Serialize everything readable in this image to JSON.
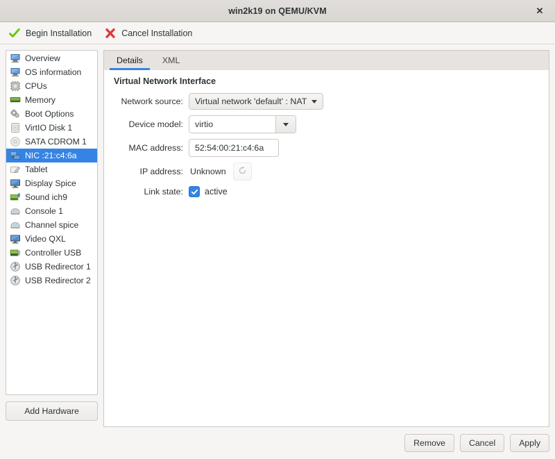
{
  "window": {
    "title": "win2k19 on QEMU/KVM",
    "close_label": "✕"
  },
  "toolbar": {
    "begin_label": "Begin Installation",
    "begin_icon": "check-mark-icon",
    "cancel_label": "Cancel Installation",
    "cancel_icon": "x-mark-icon"
  },
  "sidebar": {
    "items": [
      {
        "label": "Overview",
        "icon": "computer-icon",
        "selected": false
      },
      {
        "label": "OS information",
        "icon": "computer-icon",
        "selected": false
      },
      {
        "label": "CPUs",
        "icon": "cpu-chip-icon",
        "selected": false
      },
      {
        "label": "Memory",
        "icon": "memory-module-icon",
        "selected": false
      },
      {
        "label": "Boot Options",
        "icon": "gears-icon",
        "selected": false
      },
      {
        "label": "VirtIO Disk 1",
        "icon": "hard-disk-icon",
        "selected": false
      },
      {
        "label": "SATA CDROM 1",
        "icon": "optical-disc-icon",
        "selected": false
      },
      {
        "label": "NIC :21:c4:6a",
        "icon": "network-card-icon",
        "selected": true
      },
      {
        "label": "Tablet",
        "icon": "stylus-tablet-icon",
        "selected": false
      },
      {
        "label": "Display Spice",
        "icon": "display-monitor-icon",
        "selected": false
      },
      {
        "label": "Sound ich9",
        "icon": "sound-card-icon",
        "selected": false
      },
      {
        "label": "Console 1",
        "icon": "console-icon",
        "selected": false
      },
      {
        "label": "Channel spice",
        "icon": "console-icon",
        "selected": false
      },
      {
        "label": "Video QXL",
        "icon": "display-monitor-icon",
        "selected": false
      },
      {
        "label": "Controller USB",
        "icon": "controller-card-icon",
        "selected": false
      },
      {
        "label": "USB Redirector 1",
        "icon": "usb-icon",
        "selected": false
      },
      {
        "label": "USB Redirector 2",
        "icon": "usb-icon",
        "selected": false
      }
    ],
    "add_hardware_label": "Add Hardware"
  },
  "main": {
    "tabs": [
      {
        "label": "Details",
        "active": true
      },
      {
        "label": "XML",
        "active": false
      }
    ],
    "section_title": "Virtual Network Interface",
    "fields": {
      "network_source_label": "Network source:",
      "network_source_value": "Virtual network 'default' : NAT",
      "device_model_label": "Device model:",
      "device_model_value": "virtio",
      "mac_address_label": "MAC address:",
      "mac_address_value": "52:54:00:21:c4:6a",
      "ip_address_label": "IP address:",
      "ip_address_value": "Unknown",
      "ip_refresh_icon": "refresh-icon",
      "link_state_label": "Link state:",
      "link_state_value": "active",
      "link_state_checked": true
    }
  },
  "footer": {
    "remove_label": "Remove",
    "cancel_label": "Cancel",
    "apply_label": "Apply"
  },
  "colors": {
    "selection_blue": "#3584e4",
    "window_bg": "#f6f5f4",
    "accent_green": "#73d216",
    "accent_red": "#e04343"
  }
}
